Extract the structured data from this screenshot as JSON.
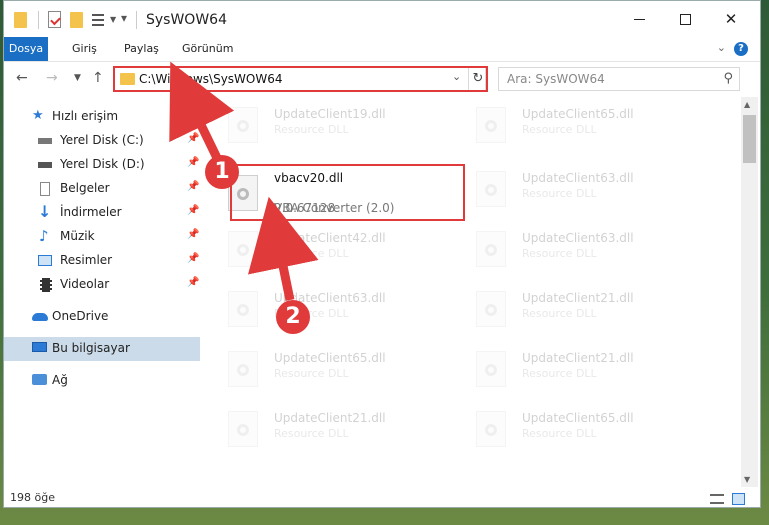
{
  "window": {
    "title": "SysWOW64"
  },
  "ribbon": {
    "tabs": [
      "Dosya",
      "Giriş",
      "Paylaş",
      "Görünüm"
    ],
    "help_label": "?"
  },
  "nav": {
    "address": "C:\\Windows\\SysWOW64",
    "search_placeholder": "Ara: SysWOW64"
  },
  "sidebar": {
    "items": [
      {
        "label": "Hızlı erişim",
        "icon": "star-icon"
      },
      {
        "label": "Yerel Disk (C:)",
        "icon": "drive-icon"
      },
      {
        "label": "Yerel Disk (D:)",
        "icon": "drive-icon"
      },
      {
        "label": "Belgeler",
        "icon": "documents-icon"
      },
      {
        "label": "İndirmeler",
        "icon": "download-icon"
      },
      {
        "label": "Müzik",
        "icon": "music-icon"
      },
      {
        "label": "Resimler",
        "icon": "pictures-icon"
      },
      {
        "label": "Videolar",
        "icon": "video-icon"
      },
      {
        "label": "OneDrive",
        "icon": "cloud-icon"
      },
      {
        "label": "Bu bilgisayar",
        "icon": "computer-icon"
      },
      {
        "label": "Ağ",
        "icon": "network-icon"
      }
    ]
  },
  "files": {
    "left": [
      {
        "name": "UpdateClient19.dll",
        "desc": "Resource DLL"
      },
      {
        "name": "vbacv20.dll",
        "version": "2.0.67128",
        "desc": "VBA Converter (2.0)"
      },
      {
        "name": "UpdateClient42.dll",
        "desc": "Resource DLL"
      },
      {
        "name": "UpdateClient63.dll",
        "desc": "Resource DLL"
      },
      {
        "name": "UpdateClient65.dll",
        "desc": "Resource DLL"
      },
      {
        "name": "UpdateClient21.dll",
        "desc": "Resource DLL"
      }
    ],
    "right": [
      {
        "name": "UpdateClient65.dll",
        "desc": "Resource DLL"
      },
      {
        "name": "UpdateClient63.dll",
        "desc": "Resource DLL"
      },
      {
        "name": "UpdateClient63.dll",
        "desc": "Resource DLL"
      },
      {
        "name": "UpdateClient21.dll",
        "desc": "Resource DLL"
      },
      {
        "name": "UpdateClient21.dll",
        "desc": "Resource DLL"
      },
      {
        "name": "UpdateClient65.dll",
        "desc": "Resource DLL"
      }
    ]
  },
  "status": {
    "count": "198 öğe"
  },
  "annotations": {
    "step1": "1",
    "step2": "2"
  },
  "colors": {
    "accent": "#1a6fc4",
    "highlight": "#e03a3a",
    "selection": "#ccdbe9"
  }
}
